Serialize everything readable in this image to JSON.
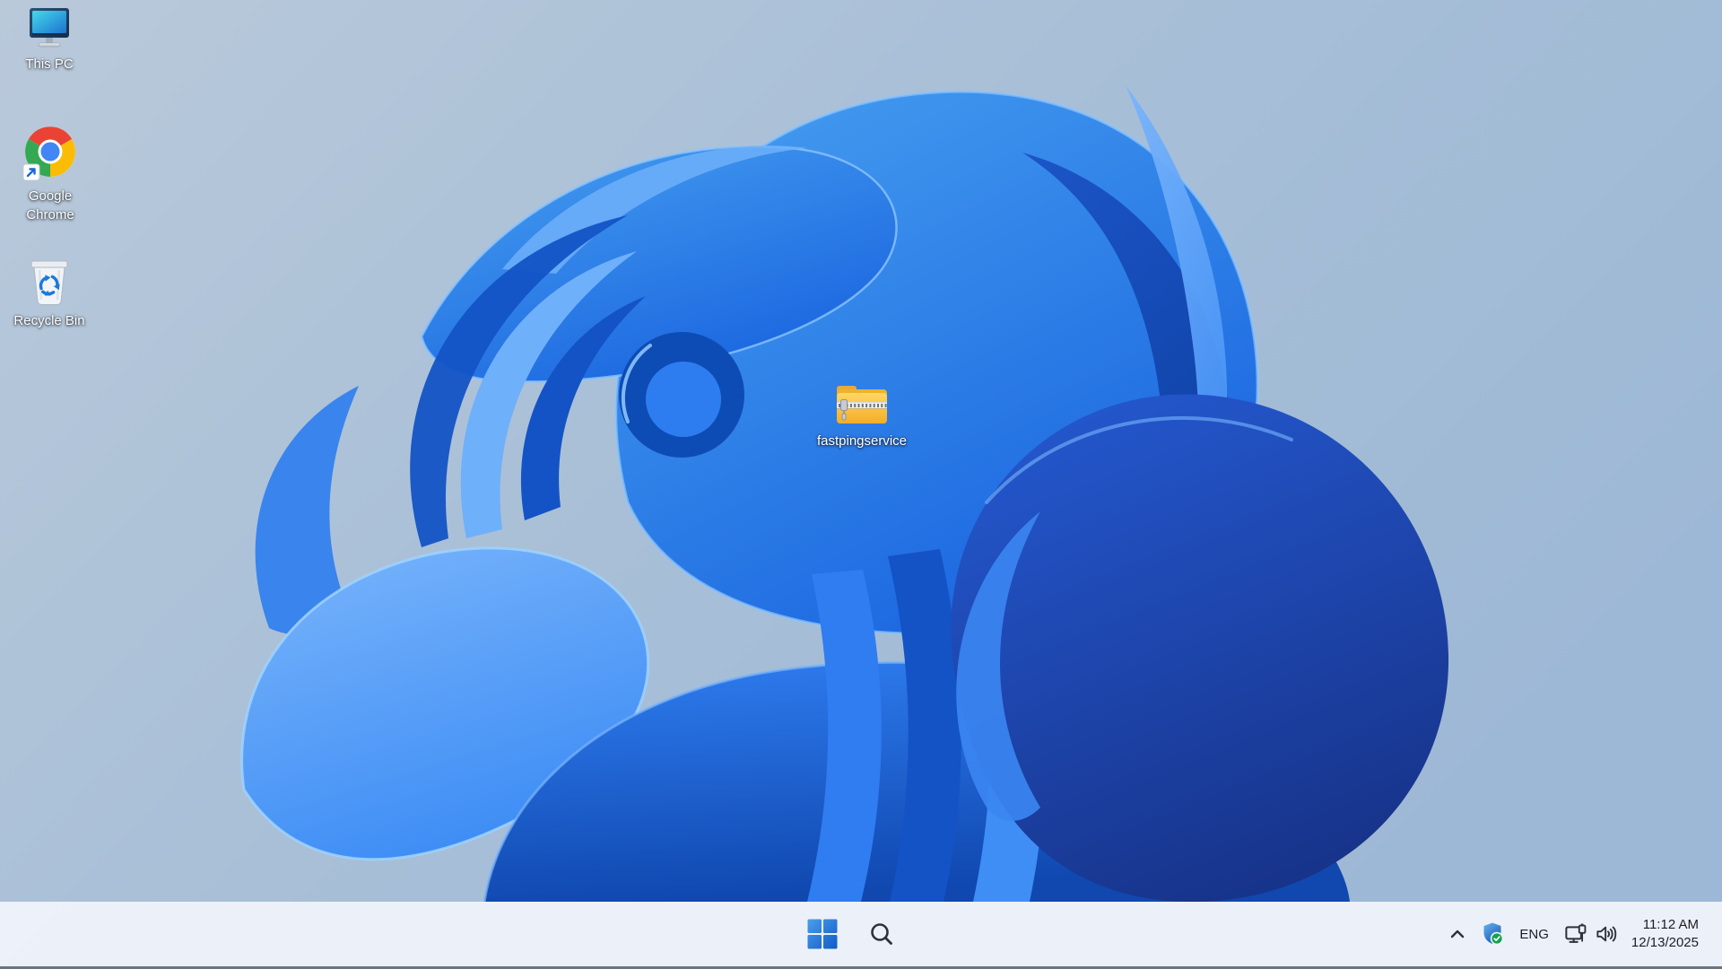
{
  "wallpaper": {
    "name": "windows-11-bloom"
  },
  "desktop_icons": [
    {
      "id": "this-pc",
      "label": "This PC"
    },
    {
      "id": "google-chrome",
      "label": "Google Chrome"
    },
    {
      "id": "recycle-bin",
      "label": "Recycle Bin"
    },
    {
      "id": "zip-folder",
      "label": "fastpingservice"
    }
  ],
  "taskbar": {
    "tray": {
      "language": "ENG",
      "time": "11:12 AM",
      "date": "12/13/2025"
    }
  },
  "colors": {
    "taskbar_bg": "#eef3fa",
    "bloom_blue": "#2e7df0",
    "bloom_navy": "#16379b",
    "desktop_sky": "#a7bdd6",
    "tray_text": "#1b1e23",
    "shield_green": "#15a24b"
  }
}
